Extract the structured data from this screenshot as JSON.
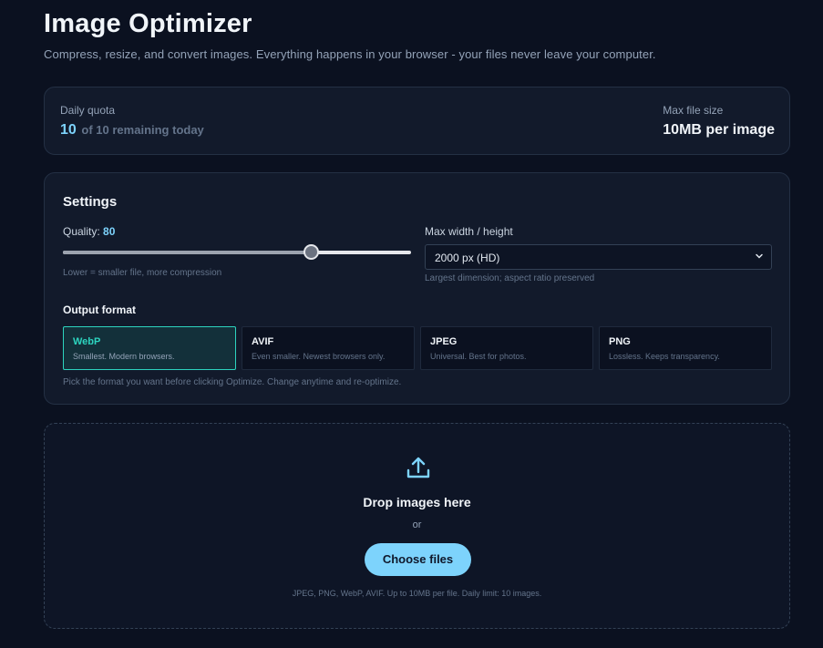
{
  "header": {
    "title": "Image Optimizer",
    "subtitle": "Compress, resize, and convert images. Everything happens in your browser - your files never leave your computer."
  },
  "quota": {
    "label": "Daily quota",
    "remaining": "10",
    "remaining_text": "of 10 remaining today",
    "max_size_label": "Max file size",
    "max_size_value": "10MB per image"
  },
  "settings": {
    "title": "Settings",
    "quality_label": "Quality:",
    "quality_value": "80",
    "quality_number": 80,
    "quality_hint": "Lower = smaller file, more compression",
    "maxwh_label": "Max width / height",
    "maxwh_selected": "2000 px (HD)",
    "maxwh_hint": "Largest dimension; aspect ratio preserved",
    "output_label": "Output format",
    "formats": [
      {
        "name": "WebP",
        "desc": "Smallest. Modern browsers.",
        "active": true
      },
      {
        "name": "AVIF",
        "desc": "Even smaller. Newest browsers only.",
        "active": false
      },
      {
        "name": "JPEG",
        "desc": "Universal. Best for photos.",
        "active": false
      },
      {
        "name": "PNG",
        "desc": "Lossless. Keeps transparency.",
        "active": false
      }
    ],
    "format_hint": "Pick the format you want before clicking Optimize. Change anytime and re-optimize."
  },
  "dropzone": {
    "title": "Drop images here",
    "or": "or",
    "button": "Choose files",
    "hint": "JPEG, PNG, WebP, AVIF. Up to 10MB per file. Daily limit: 10 images."
  },
  "colors": {
    "accent": "#7dd3fc",
    "active_format": "#2dd4bf",
    "background": "#0b1120"
  }
}
